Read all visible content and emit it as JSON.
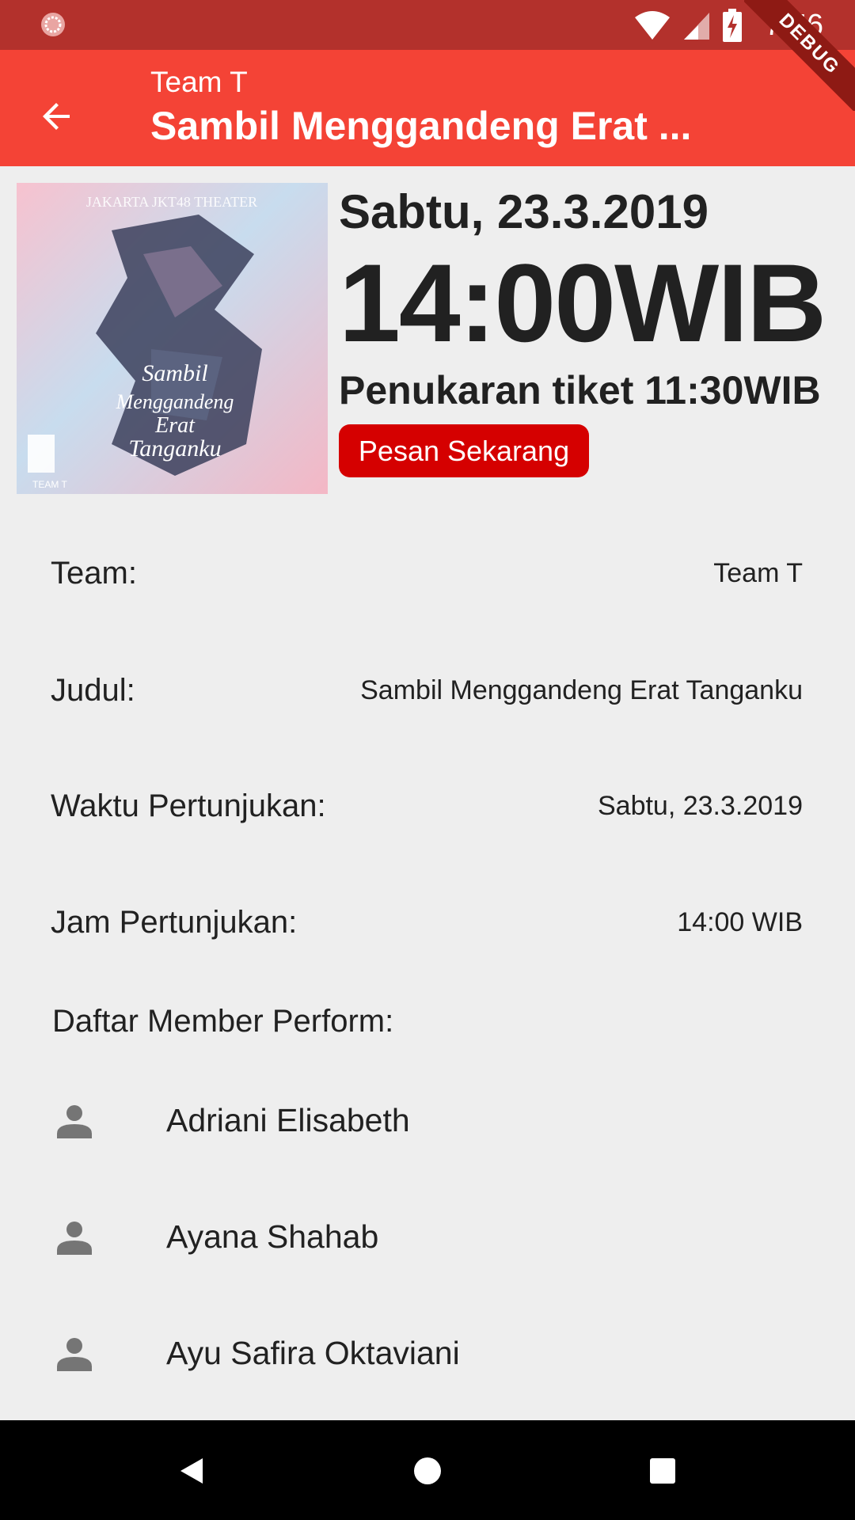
{
  "status_bar": {
    "time": "7:56",
    "icons": [
      "app-notification-icon",
      "wifi-icon",
      "cellular-signal-icon",
      "battery-charging-icon"
    ]
  },
  "debug_banner": "DEBUG",
  "app_bar": {
    "subtitle": "Team T",
    "title": "Sambil Menggandeng Erat ...",
    "back_icon": "arrow-back-icon",
    "color": "#f44336"
  },
  "poster": {
    "alt": "Sambil Menggandeng Erat Tanganku poster",
    "header_text": "JAKARTA JKT48 THEATER",
    "footer_text": "TEAM T"
  },
  "show": {
    "date": "Sabtu, 23.3.2019",
    "time": "14:00WIB",
    "ticket_exchange": "Penukaran tiket 11:30WIB",
    "order_button": "Pesan Sekarang",
    "order_button_color": "#d50000"
  },
  "details": [
    {
      "label": "Team:",
      "value": "Team T"
    },
    {
      "label": "Judul:",
      "value": "Sambil Menggandeng Erat Tanganku"
    },
    {
      "label": "Waktu Pertunjukan:",
      "value": "Sabtu, 23.3.2019"
    },
    {
      "label": "Jam Pertunjukan:",
      "value": "14:00 WIB"
    }
  ],
  "members_heading": "Daftar Member Perform:",
  "members": [
    {
      "name": "Adriani Elisabeth"
    },
    {
      "name": "Ayana Shahab"
    },
    {
      "name": "Ayu Safira Oktaviani"
    }
  ],
  "nav_bar": {
    "icons": [
      "back-triangle-icon",
      "home-circle-icon",
      "recents-square-icon"
    ]
  }
}
